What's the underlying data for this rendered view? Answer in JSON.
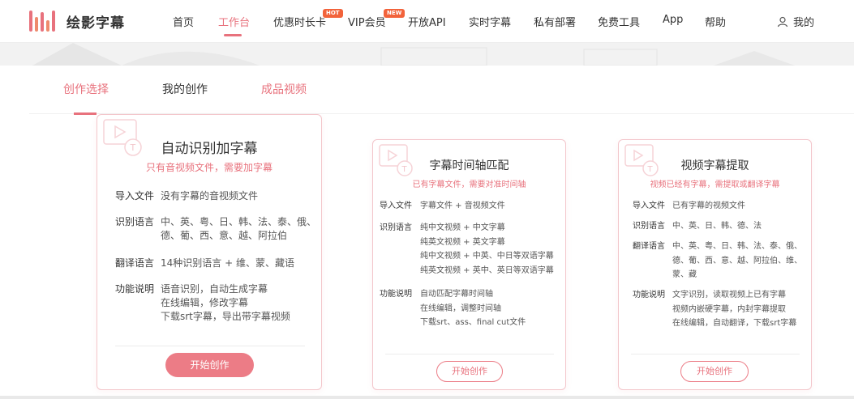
{
  "brand": {
    "name": "绘影字幕",
    "accent": "#e8727d"
  },
  "nav": {
    "items": [
      {
        "label": "首页"
      },
      {
        "label": "工作台"
      },
      {
        "label": "优惠时长卡",
        "badge": "HOT"
      },
      {
        "label": "VIP会员",
        "badge": "NEW"
      },
      {
        "label": "开放API"
      },
      {
        "label": "实时字幕"
      },
      {
        "label": "私有部署"
      },
      {
        "label": "免费工具"
      },
      {
        "label": "App"
      },
      {
        "label": "帮助"
      }
    ],
    "active": "工作台",
    "user_label": "我的"
  },
  "tabs": [
    {
      "label": "创作选择"
    },
    {
      "label": "我的创作"
    },
    {
      "label": "成品视频"
    }
  ],
  "cards": [
    {
      "title": "自动识别加字幕",
      "subtitle": "只有音视频文件，需要加字幕",
      "rows": [
        {
          "label": "导入文件",
          "lines": [
            "没有字幕的音视频文件"
          ]
        },
        {
          "label": "识别语言",
          "lines": [
            "中、英、粤、日、韩、法、泰、俄、",
            "德、葡、西、意、越、阿拉伯"
          ]
        },
        {
          "label": "翻译语言",
          "lines": [
            "14种识别语言 + 维、蒙、藏语"
          ]
        },
        {
          "label": "功能说明",
          "lines": [
            "语音识别，自动生成字幕",
            "在线编辑，修改字幕",
            "下载srt字幕，导出带字幕视频"
          ]
        }
      ],
      "button": "开始创作"
    },
    {
      "title": "字幕时间轴匹配",
      "subtitle": "已有字幕文件，需要对准时间轴",
      "rows": [
        {
          "label": "导入文件",
          "lines": [
            "字幕文件 + 音视频文件"
          ]
        },
        {
          "label": "识别语言",
          "lines": [
            "纯中文视频 + 中文字幕",
            "纯英文视频 + 英文字幕",
            "纯中文视频 + 中英、中日等双语字幕",
            "纯英文视频 + 英中、英日等双语字幕"
          ]
        },
        {
          "label": "功能说明",
          "lines": [
            "自动匹配字幕时间轴",
            "在线编辑，调整时间轴",
            "下载srt、ass、final cut文件"
          ]
        }
      ],
      "button": "开始创作"
    },
    {
      "title": "视频字幕提取",
      "subtitle": "视频已经有字幕，需提取或翻译字幕",
      "rows": [
        {
          "label": "导入文件",
          "lines": [
            "已有字幕的视频文件"
          ]
        },
        {
          "label": "识别语言",
          "lines": [
            "中、英、日、韩、德、法"
          ]
        },
        {
          "label": "翻译语言",
          "lines": [
            "中、英、粤、日、韩、法、泰、俄、",
            "德、葡、西、意、越、阿拉伯、维、",
            "蒙、藏"
          ]
        },
        {
          "label": "功能说明",
          "lines": [
            "文字识别，读取视频上已有字幕",
            "视频内嵌硬字幕，内封字幕提取",
            "在线编辑，自动翻译，下载srt字幕"
          ]
        }
      ],
      "button": "开始创作"
    }
  ]
}
